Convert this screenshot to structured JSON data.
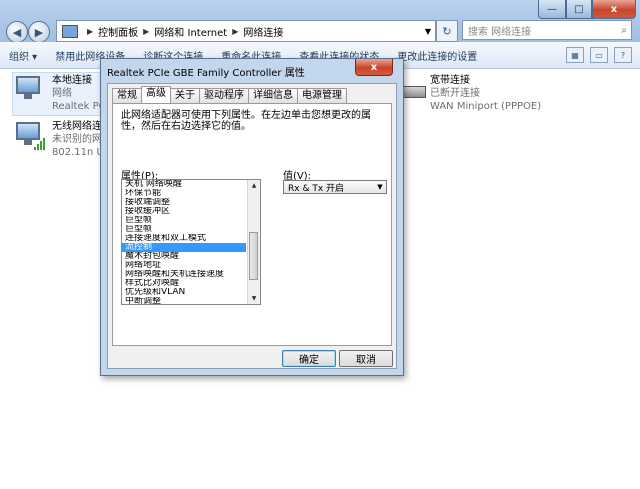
{
  "explorer": {
    "breadcrumb": [
      "控制面板",
      "网络和 Internet",
      "网络连接"
    ],
    "search_placeholder": "搜索 网络连接",
    "window_buttons": {
      "minimize": "—",
      "maximize": "□",
      "close": "x"
    },
    "toolbar": [
      "组织 ▾",
      "禁用此网络设备",
      "诊断这个连接",
      "重命名此连接",
      "查看此连接的状态",
      "更改此连接的设置"
    ],
    "connections": [
      {
        "name": "本地连接",
        "status": "网络",
        "device": "Realtek PC"
      },
      {
        "name": "无线网络连",
        "status": "未识别的网络",
        "device": "802.11n U"
      },
      {
        "name": "宽带连接",
        "status": "已断开连接",
        "device": "WAN Miniport (PPPOE)"
      }
    ]
  },
  "dialog": {
    "title": "Realtek PCIe GBE Family Controller 属性",
    "close_label": "x",
    "tabs": [
      "常规",
      "高级",
      "关于",
      "驱动程序",
      "详细信息",
      "电源管理"
    ],
    "active_tab": 1,
    "description": "此网络适配器可使用下列属性。在左边单击您想更改的属性，然后在右边选择它的值。",
    "property_label": "属性(P):",
    "value_label": "值(V):",
    "properties": [
      "关机 网络唤醒",
      "环保节能",
      "接收端调整",
      "接收缓冲区",
      "巨型帧",
      "巨型帧",
      "连接速度和双工模式",
      "流控制",
      "魔术封包唤醒",
      "网络地址",
      "网络唤醒和关机连接速度",
      "样式比对唤醒",
      "优先级和VLAN",
      "中断调整"
    ],
    "selected_index": 7,
    "value": "Rx & Tx 开启",
    "ok_label": "确定",
    "cancel_label": "取消"
  }
}
